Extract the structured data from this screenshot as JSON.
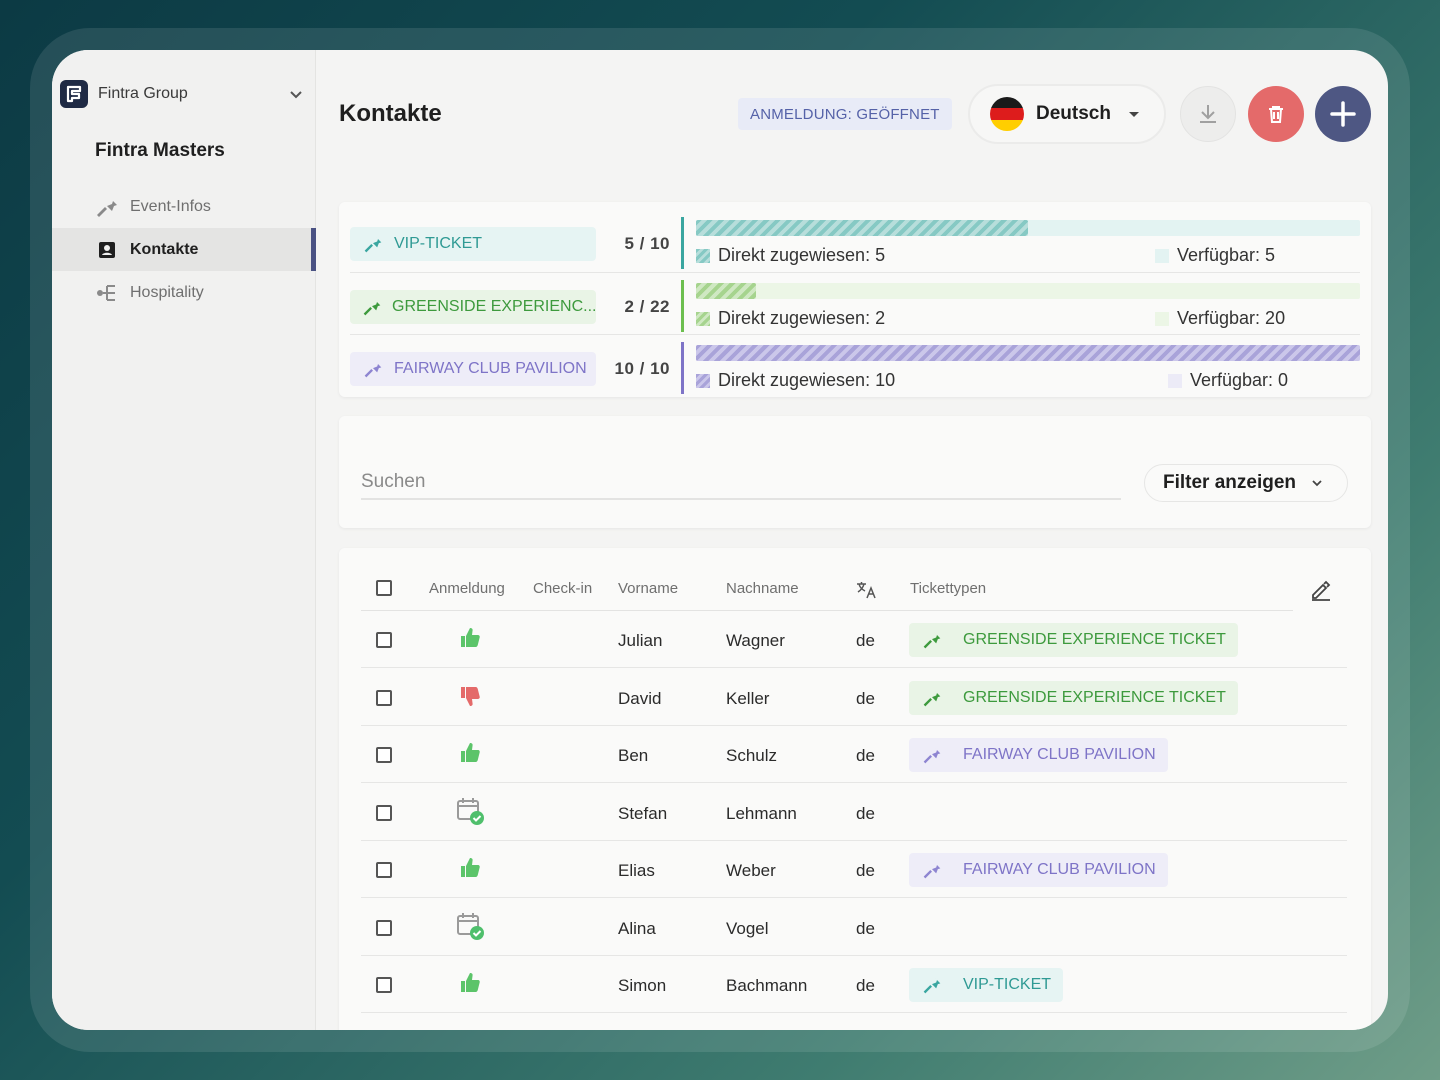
{
  "sidebar": {
    "org_name": "Fintra Group",
    "event_name": "Fintra Masters",
    "items": [
      {
        "label": "Event-Infos",
        "icon": "ticket-icon",
        "active": false
      },
      {
        "label": "Kontakte",
        "icon": "contact-card-icon",
        "active": true
      },
      {
        "label": "Hospitality",
        "icon": "hierarchy-icon",
        "active": false
      }
    ]
  },
  "header": {
    "title": "Kontakte",
    "status": "ANMELDUNG: GEÖFFNET",
    "language": "Deutsch"
  },
  "colors": {
    "accent": "#4e5783",
    "delete": "#e46a6a",
    "vip": "#3aa6a0",
    "greenside": "#3d9a3d",
    "fairway": "#7e74c7"
  },
  "tickets": [
    {
      "name": "VIP-TICKET",
      "count": "5 / 10",
      "assigned_label": "Direkt zugewiesen: 5",
      "free_label": "Verfügbar: 5",
      "assigned": 5,
      "total": 10
    },
    {
      "name": "GREENSIDE EXPERIENC...",
      "count": "2 / 22",
      "assigned_label": "Direkt zugewiesen: 2",
      "free_label": "Verfügbar: 20",
      "assigned": 2,
      "total": 22
    },
    {
      "name": "FAIRWAY CLUB PAVILION",
      "count": "10 / 10",
      "assigned_label": "Direkt zugewiesen: 10",
      "free_label": "Verfügbar: 0",
      "assigned": 10,
      "total": 10
    }
  ],
  "search": {
    "placeholder": "Suchen",
    "filter_label": "Filter anzeigen"
  },
  "table": {
    "columns": [
      "Anmeldung",
      "Check-in",
      "Vorname",
      "Nachname",
      "Tickettypen"
    ],
    "rows": [
      {
        "status": "thumbs-up",
        "first": "Julian",
        "last": "Wagner",
        "lang": "de",
        "ticket": "GREENSIDE EXPERIENCE TICKET",
        "ticket_kind": "greenside"
      },
      {
        "status": "thumbs-down",
        "first": "David",
        "last": "Keller",
        "lang": "de",
        "ticket": "GREENSIDE EXPERIENCE TICKET",
        "ticket_kind": "greenside"
      },
      {
        "status": "thumbs-up",
        "first": "Ben",
        "last": "Schulz",
        "lang": "de",
        "ticket": "FAIRWAY CLUB PAVILION",
        "ticket_kind": "fairway"
      },
      {
        "status": "calendar-check",
        "first": "Stefan",
        "last": "Lehmann",
        "lang": "de",
        "ticket": "",
        "ticket_kind": ""
      },
      {
        "status": "thumbs-up",
        "first": "Elias",
        "last": "Weber",
        "lang": "de",
        "ticket": "FAIRWAY CLUB PAVILION",
        "ticket_kind": "fairway"
      },
      {
        "status": "calendar-check",
        "first": "Alina",
        "last": "Vogel",
        "lang": "de",
        "ticket": "",
        "ticket_kind": ""
      },
      {
        "status": "thumbs-up",
        "first": "Simon",
        "last": "Bachmann",
        "lang": "de",
        "ticket": "VIP-TICKET",
        "ticket_kind": "vip"
      }
    ]
  }
}
